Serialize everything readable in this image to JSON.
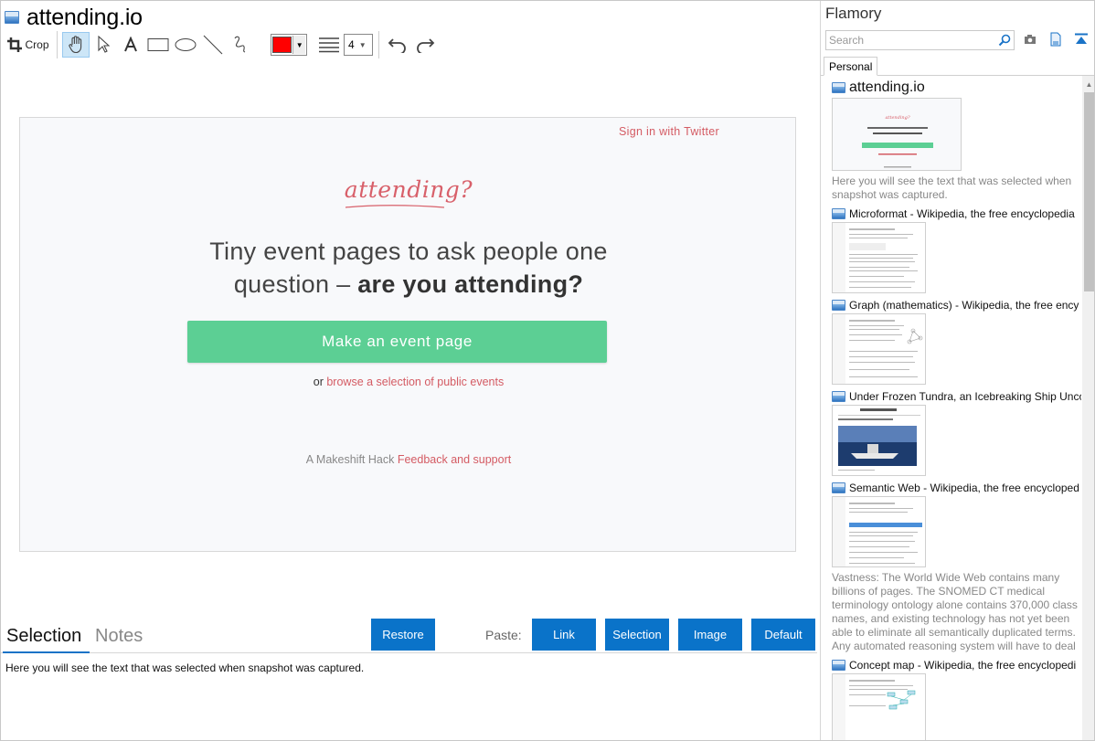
{
  "window": {
    "title": "attending.io"
  },
  "toolbar": {
    "crop_label": "Crop",
    "tools": [
      "hand-icon",
      "pointer-icon",
      "text-icon",
      "rectangle-icon",
      "ellipse-icon",
      "line-icon",
      "freehand-icon"
    ],
    "active_tool": "hand-icon",
    "color": "#ff0000",
    "line_width": "4"
  },
  "snapshot": {
    "sign_in": "Sign in with Twitter",
    "logo": "attending?",
    "headline_1": "Tiny event pages to ask people one",
    "headline_2_pre": "question – ",
    "headline_2_bold": "are you attending?",
    "cta": "Make an event page",
    "browse_pre": "or ",
    "browse_link": "browse a selection of public events",
    "footer_pre": "A Makeshift Hack ",
    "footer_link": "Feedback and support",
    "accent_color": "#5ccf94",
    "link_color": "#d45b63"
  },
  "bottom": {
    "tab_selection": "Selection",
    "tab_notes": "Notes",
    "restore": "Restore",
    "paste_label": "Paste:",
    "paste_link": "Link",
    "paste_selection": "Selection",
    "paste_image": "Image",
    "paste_default": "Default",
    "selection_text": "Here you will see the text that was selected when snapshot was captured.",
    "button_color": "#0a73c9"
  },
  "sidebar": {
    "title": "Flamory",
    "search_placeholder": "Search",
    "tab": "Personal",
    "items": [
      {
        "title": "attending.io",
        "caption": "Here you will see the text that was selected when snapshot was captured."
      },
      {
        "title": "Microformat - Wikipedia, the free encyclopedia",
        "caption": ""
      },
      {
        "title": "Graph (mathematics) - Wikipedia, the free ency",
        "caption": ""
      },
      {
        "title": "Under Frozen Tundra, an Icebreaking Ship Unco",
        "caption": ""
      },
      {
        "title": "Semantic Web - Wikipedia, the free encycloped",
        "caption": "Vastness: The World Wide Web contains many billions of pages. The SNOMED CT medical terminology ontology alone contains 370,000 class names, and existing technology has not yet been able to eliminate all semantically duplicated terms. Any automated reasoning system will have to deal with truly huge inputs."
      },
      {
        "title": "Concept map - Wikipedia, the free encyclopedi",
        "caption": ""
      }
    ]
  }
}
